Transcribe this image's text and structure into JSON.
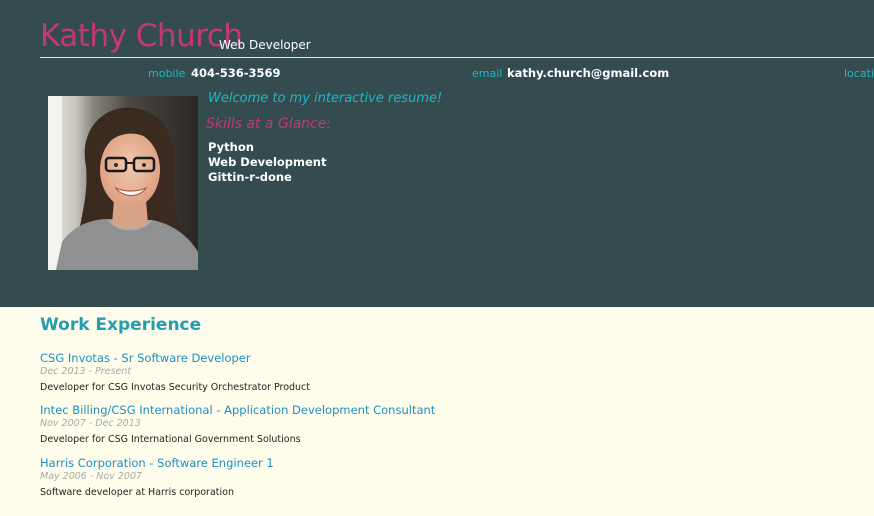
{
  "header": {
    "name": "Kathy Church",
    "role": "Web Developer",
    "contacts": [
      {
        "label": "mobile",
        "value": "404-536-3569"
      },
      {
        "label": "email",
        "value": "kathy.church@gmail.com"
      },
      {
        "label": "locati",
        "value": ""
      }
    ],
    "welcome_message": "Welcome to my interactive resume!",
    "skills_heading": "Skills at a Glance:",
    "skills": [
      "Python",
      "Web Development",
      "Gittin-r-done"
    ]
  },
  "work": {
    "heading": "Work Experience",
    "jobs": [
      {
        "title": "CSG Invotas - Sr Software Developer",
        "dates": "Dec 2013 - Present",
        "description": "Developer for CSG Invotas Security Orchestrator Product"
      },
      {
        "title": "Intec Billing/CSG International - Application Development Consultant",
        "dates": "Nov 2007 - Dec 2013",
        "description": "Developer for CSG International Government Solutions"
      },
      {
        "title": "Harris Corporation - Software Engineer 1",
        "dates": "May 2006 - Nov 2007",
        "description": "Software developer at Harris corporation"
      }
    ]
  },
  "colors": {
    "header_bg": "#344c4d",
    "page_bg": "#fefdeb",
    "name": "#c63874",
    "accent_teal": "#1fb6c7",
    "link_blue": "#1c8fc2"
  }
}
